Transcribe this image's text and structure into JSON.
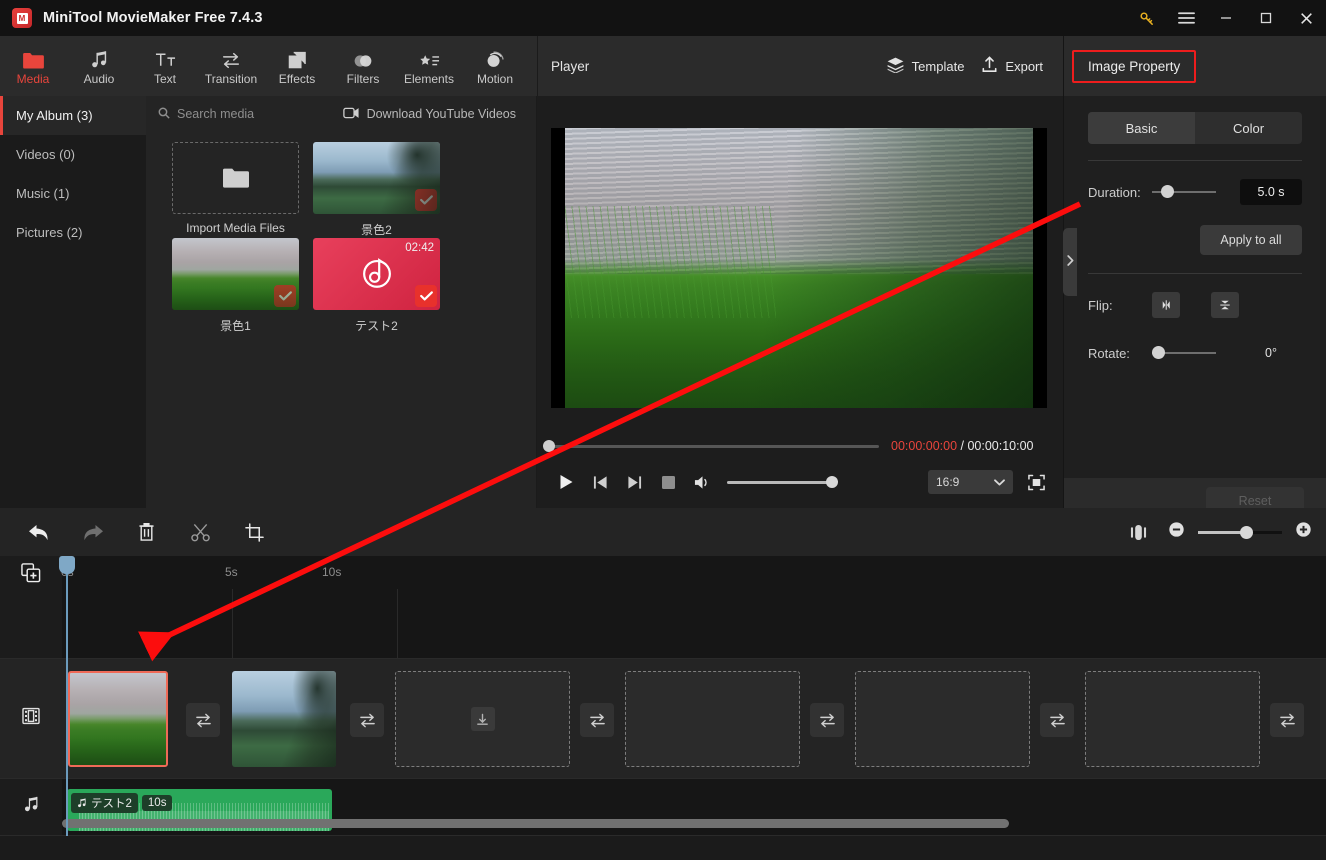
{
  "window": {
    "title": "MiniTool MovieMaker Free 7.4.3",
    "controls": {
      "key": "key-icon",
      "menu": "hamburger-icon",
      "minimize": "—",
      "maximize": "▢",
      "close": "✕"
    }
  },
  "toolbar": {
    "items": [
      {
        "label": "Media",
        "icon": "folder-icon",
        "active": true
      },
      {
        "label": "Audio",
        "icon": "music-note-icon",
        "active": false
      },
      {
        "label": "Text",
        "icon": "text-icon",
        "active": false
      },
      {
        "label": "Transition",
        "icon": "transition-arrows-icon",
        "active": false
      },
      {
        "label": "Effects",
        "icon": "layers-square-icon",
        "active": false
      },
      {
        "label": "Filters",
        "icon": "circles-icon",
        "active": false
      },
      {
        "label": "Elements",
        "icon": "star-list-icon",
        "active": false
      },
      {
        "label": "Motion",
        "icon": "motion-circle-icon",
        "active": false
      }
    ]
  },
  "sidebar": {
    "items": [
      {
        "label": "My Album (3)",
        "active": true
      },
      {
        "label": "Videos (0)",
        "active": false
      },
      {
        "label": "Music (1)",
        "active": false
      },
      {
        "label": "Pictures (2)",
        "active": false
      }
    ]
  },
  "media": {
    "search_placeholder": "Search media",
    "download_label": "Download YouTube Videos",
    "import_label": "Import Media Files",
    "items": [
      {
        "label": "景色2",
        "checked": true,
        "duration": ""
      },
      {
        "label": "景色1",
        "checked": true,
        "duration": ""
      },
      {
        "label": "テスト2",
        "checked": true,
        "duration": "02:42"
      }
    ]
  },
  "player": {
    "title": "Player",
    "template_label": "Template",
    "export_label": "Export",
    "current_time": "00:00:00:00",
    "separator": " / ",
    "total_time": "00:00:10:00",
    "aspect_ratio": "16:9",
    "collapse_icon": "chevron-right-icon",
    "controls": {
      "play": "play-icon",
      "prev": "previous-frame-icon",
      "next": "next-frame-icon",
      "stop": "stop-icon",
      "volume": "volume-icon",
      "fullscreen": "fullscreen-icon"
    }
  },
  "property_panel": {
    "title": "Image Property",
    "title_highlight_color": "#ee1d1d",
    "tabs": [
      {
        "label": "Basic",
        "active": true
      },
      {
        "label": "Color",
        "active": false
      }
    ],
    "duration_label": "Duration:",
    "duration_value": "5.0 s",
    "apply_to_all_label": "Apply to all",
    "flip_label": "Flip:",
    "flip_horizontal_icon": "flip-horizontal-icon",
    "flip_vertical_icon": "flip-vertical-icon",
    "rotate_label": "Rotate:",
    "rotate_value": "0°",
    "reset_label": "Reset"
  },
  "timeline": {
    "tools": [
      {
        "name": "undo",
        "icon": "undo-arrow-icon"
      },
      {
        "name": "redo",
        "icon": "redo-arrow-icon"
      },
      {
        "name": "delete",
        "icon": "trash-icon"
      },
      {
        "name": "split",
        "icon": "scissors-icon"
      },
      {
        "name": "crop",
        "icon": "crop-icon"
      }
    ],
    "zoom": {
      "fit_icon": "fit-timeline-icon",
      "minus": "−",
      "plus": "+"
    },
    "ruler_ticks": [
      "0s",
      "5s",
      "10s"
    ],
    "track_add_icon": "add-track-icon",
    "video_track_icon": "film-strip-icon",
    "audio_track_icon": "music-note-icon",
    "video_clips": [
      {
        "type": "image",
        "selected": true,
        "thumb": "grass"
      },
      {
        "type": "image",
        "selected": false,
        "thumb": "lake"
      },
      {
        "type": "empty-slot",
        "selected": false,
        "thumb": ""
      },
      {
        "type": "empty-slot",
        "selected": false,
        "thumb": ""
      },
      {
        "type": "empty-slot",
        "selected": false,
        "thumb": ""
      },
      {
        "type": "empty-slot",
        "selected": false,
        "thumb": ""
      }
    ],
    "transition_icon": "transition-arrows-icon",
    "audio_clip": {
      "name": "テスト2",
      "length": "10s",
      "color": "#2aa85a"
    }
  }
}
